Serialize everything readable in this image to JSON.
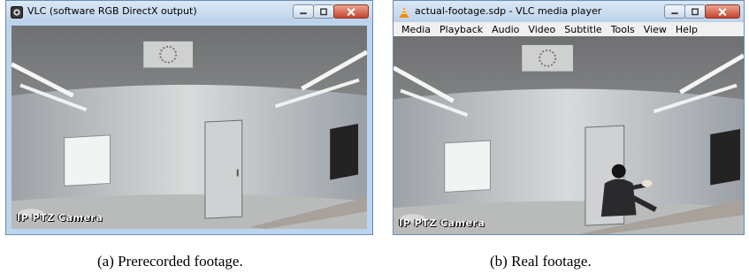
{
  "figure": {
    "panel_a": {
      "window_title": "VLC (software RGB DirectX output)",
      "overlay_label": "IP PTZ Camera",
      "caption": "(a) Prerecorded footage."
    },
    "panel_b": {
      "window_title": "actual-footage.sdp - VLC media player",
      "menu": [
        "Media",
        "Playback",
        "Audio",
        "Video",
        "Subtitle",
        "Tools",
        "View",
        "Help"
      ],
      "overlay_label": "IP PTZ Camera",
      "caption": "(b) Real footage."
    }
  },
  "icons": {
    "window_icon_a": "camera-icon",
    "window_icon_b": "vlc-cone-icon",
    "minimize": "minimize-icon",
    "maximize": "maximize-icon",
    "close": "close-icon"
  },
  "colors": {
    "titlebar": "#bcd2ea",
    "close_button": "#c7442b",
    "vlc_orange": "#f08a00",
    "wall": "#d9dbdb"
  }
}
